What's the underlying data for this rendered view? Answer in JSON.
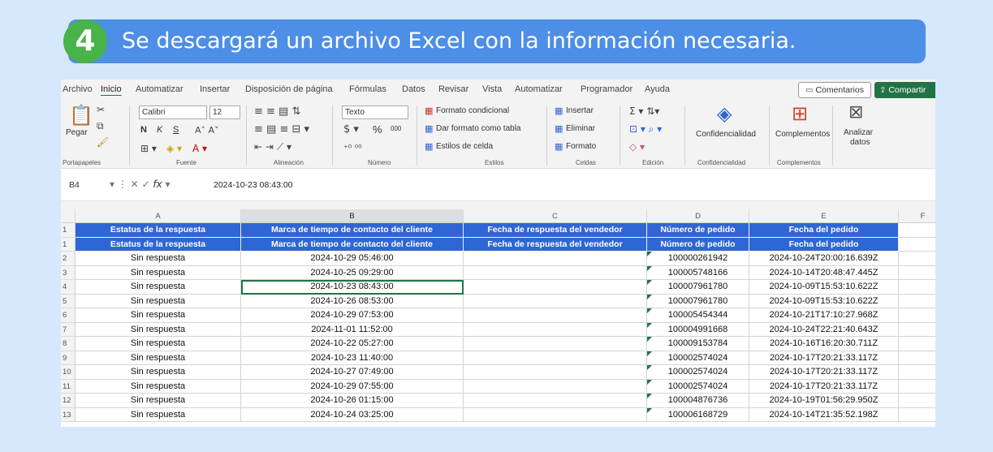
{
  "step": {
    "number": "4",
    "text": "Se descargará un archivo Excel con la información necesaria."
  },
  "excel": {
    "menu": [
      "Archivo",
      "Inicio",
      "Automatizar",
      "Insertar",
      "Disposición de página",
      "Fórmulas",
      "Datos",
      "Revisar",
      "Vista",
      "Automatizar",
      "Programador",
      "Ayuda"
    ],
    "active_menu": "Inicio",
    "comments_label": "Comentarios",
    "share_label": "Compartir",
    "ribbon": {
      "portapapeles": {
        "paste": "Pegar",
        "label": "Portapapeles"
      },
      "fuente": {
        "font_name": "Calibri",
        "font_size": "12",
        "bold": "N",
        "italic": "K",
        "underline": "S",
        "label": "Fuente"
      },
      "alineacion": {
        "label": "Alineación"
      },
      "numero": {
        "format": "Texto",
        "percent": "%",
        "thousands": "000",
        "label": "Número"
      },
      "estilos": {
        "conditional": "Formato condicional",
        "table": "Dar formato como tabla",
        "cell_styles": "Estilos de celda",
        "label": "Estilos"
      },
      "celdas": {
        "insert": "Insertar",
        "delete": "Eliminar",
        "format": "Formato",
        "label": "Celdas"
      },
      "edicion": {
        "label": "Edición"
      },
      "confidencialidad": {
        "button": "Confidencialidad",
        "label": "Confidencialidad"
      },
      "complementos": {
        "button": "Complementos",
        "label": "Complementos"
      },
      "analizar": {
        "line1": "Analizar",
        "line2": "datos"
      }
    },
    "name_box": "B4",
    "formula_value": "2024-10-23 08:43:00",
    "columns": [
      "A",
      "B",
      "C",
      "D",
      "E",
      "F"
    ],
    "rows": [
      {
        "num": "1",
        "header": true,
        "a": "Estatus de la respuesta",
        "b": "Marca de tiempo de contacto del cliente",
        "c": "Fecha de respuesta del vendedor",
        "d": "Número de pedido",
        "e": "Fecha del pedido"
      },
      {
        "num": "1",
        "header": true,
        "a": "Estatus de la respuesta",
        "b": "Marca de tiempo de contacto del cliente",
        "c": "Fecha de respuesta del vendedor",
        "d": "Número de pedido",
        "e": "Fecha del pedido"
      },
      {
        "num": "2",
        "a": "Sin respuesta",
        "b": "2024-10-29 05:46:00",
        "c": "",
        "d": "100000261942",
        "e": "2024-10-24T20:00:16.639Z"
      },
      {
        "num": "3",
        "a": "Sin respuesta",
        "b": "2024-10-25 09:29:00",
        "c": "",
        "d": "100005748166",
        "e": "2024-10-14T20:48:47.445Z"
      },
      {
        "num": "4",
        "a": "Sin respuesta",
        "b": "2024-10-23 08:43:00",
        "c": "",
        "d": "100007961780",
        "e": "2024-10-09T15:53:10.622Z"
      },
      {
        "num": "5",
        "a": "Sin respuesta",
        "b": "2024-10-26 08:53:00",
        "c": "",
        "d": "100007961780",
        "e": "2024-10-09T15:53:10.622Z"
      },
      {
        "num": "6",
        "a": "Sin respuesta",
        "b": "2024-10-29 07:53:00",
        "c": "",
        "d": "100005454344",
        "e": "2024-10-21T17:10:27.968Z"
      },
      {
        "num": "7",
        "a": "Sin respuesta",
        "b": "2024-11-01 11:52:00",
        "c": "",
        "d": "100004991668",
        "e": "2024-10-24T22:21:40.643Z"
      },
      {
        "num": "8",
        "a": "Sin respuesta",
        "b": "2024-10-22 05:27:00",
        "c": "",
        "d": "100009153784",
        "e": "2024-10-16T16:20:30.711Z"
      },
      {
        "num": "9",
        "a": "Sin respuesta",
        "b": "2024-10-23 11:40:00",
        "c": "",
        "d": "100002574024",
        "e": "2024-10-17T20:21:33.117Z"
      },
      {
        "num": "10",
        "a": "Sin respuesta",
        "b": "2024-10-27 07:49:00",
        "c": "",
        "d": "100002574024",
        "e": "2024-10-17T20:21:33.117Z"
      },
      {
        "num": "11",
        "a": "Sin respuesta",
        "b": "2024-10-29 07:55:00",
        "c": "",
        "d": "100002574024",
        "e": "2024-10-17T20:21:33.117Z"
      },
      {
        "num": "12",
        "a": "Sin respuesta",
        "b": "2024-10-26 01:15:00",
        "c": "",
        "d": "100004876736",
        "e": "2024-10-19T01:56:29.950Z"
      },
      {
        "num": "13",
        "a": "Sin respuesta",
        "b": "2024-10-24 03:25:00",
        "c": "",
        "d": "100006168729",
        "e": "2024-10-14T21:35:52.198Z"
      }
    ],
    "colors": {
      "header_fill": "#2f66d6",
      "excel_green": "#217346",
      "banner": "#4d8ee6",
      "step_badge": "#47b349",
      "page_bg": "#d6e8fb"
    }
  }
}
